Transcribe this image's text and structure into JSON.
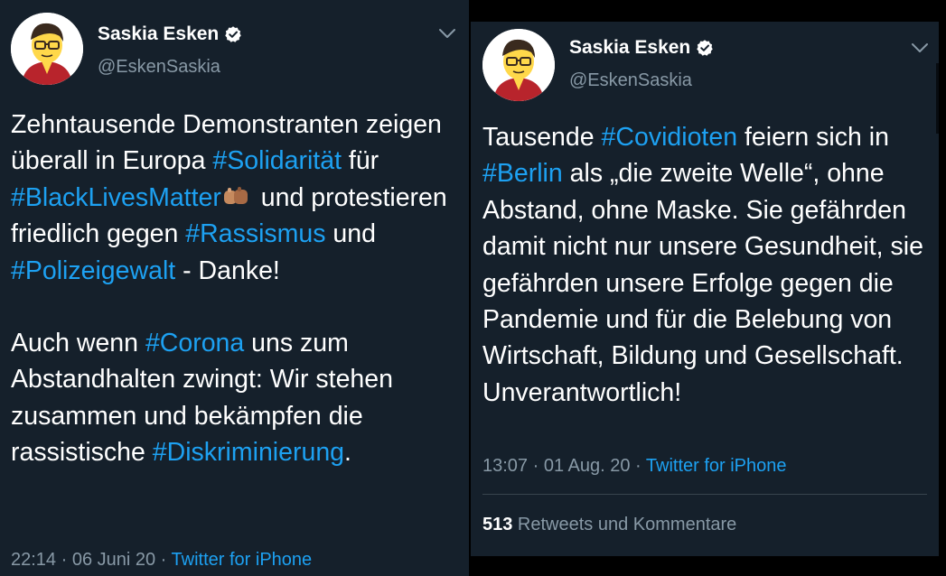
{
  "tweets": [
    {
      "author": {
        "name": "Saskia Esken",
        "handle": "@EskenSaskia",
        "verified": true
      },
      "body": {
        "p1": {
          "t1": "Zehntausende Demonstranten zeigen überall in Europa ",
          "tag1": "#Solidarität",
          "t2": " für ",
          "tag2": "#BlackLivesMatter",
          "t3": " und protestieren friedlich gegen ",
          "tag3": "#Rassismus",
          "t4": " und ",
          "tag4": "#Polizeigewalt",
          "t5": " - Danke!"
        },
        "p2": {
          "t1": "Auch wenn ",
          "tag1": "#Corona",
          "t2": " uns zum Abstandhalten zwingt: Wir stehen zusammen und bekämpfen die rassistische ",
          "tag2": "#Diskriminierung",
          "t3": "."
        }
      },
      "meta": {
        "time_date": "22:14 · 06 Juni 20 · ",
        "source": "Twitter for iPhone"
      }
    },
    {
      "author": {
        "name": "Saskia Esken",
        "handle": "@EskenSaskia",
        "verified": true
      },
      "body": {
        "t1": "Tausende ",
        "tag1": "#Covidioten",
        "t2": " feiern sich in ",
        "tag2": "#Berlin",
        "t3": " als „die zweite Welle“, ohne Abstand, ohne Maske. Sie gefährden damit nicht nur unsere Gesundheit, sie gefährden unsere Erfolge gegen die Pandemie und für die Belebung von Wirtschaft, Bildung und Gesellschaft. Unverantwortlich!"
      },
      "meta": {
        "time_date": "13:07 · 01 Aug. 20 · ",
        "source": "Twitter for iPhone"
      },
      "stats": {
        "count": "513",
        "label": " Retweets und Kommentare"
      }
    }
  ],
  "icons": {
    "verified": "verified-badge-icon",
    "menu": "chevron-down-icon",
    "emoji": "raised-fist-emoji-icon"
  },
  "colors": {
    "background": "#15202b",
    "text": "#ffffff",
    "secondary": "#8899a6",
    "link": "#1da1f2",
    "divider": "#38444d"
  }
}
